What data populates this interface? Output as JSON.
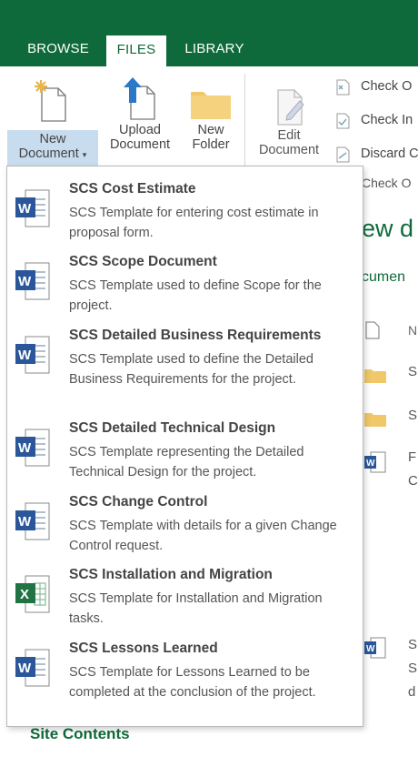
{
  "ribbon_tabs": {
    "browse": "BROWSE",
    "files": "FILES",
    "library": "LIBRARY"
  },
  "ribbon": {
    "new_document": {
      "line1": "New",
      "line2": "Document"
    },
    "upload_document": {
      "line1": "Upload",
      "line2": "Document"
    },
    "new_folder": {
      "line1": "New",
      "line2": "Folder"
    },
    "edit_document": {
      "line1": "Edit",
      "line2": "Document"
    },
    "check_out": "Check O",
    "check_in": "Check In",
    "discard": "Discard C",
    "group_label": "Check O"
  },
  "page": {
    "title": "ew d",
    "subtitle": "cumen",
    "column_header": "N",
    "rows": [
      "S",
      "S",
      "F",
      "C",
      "S",
      "S",
      "d"
    ],
    "site_contents": "Site Contents"
  },
  "menu_items": [
    {
      "title": "SCS Cost Estimate",
      "description": "SCS Template for entering cost estimate in proposal form.",
      "icon": "word-icon"
    },
    {
      "title": "SCS Scope Document",
      "description": "SCS Template used to define Scope for the project.",
      "icon": "word-icon"
    },
    {
      "title": "SCS Detailed Business Requirements",
      "description": "SCS Template used to define the Detailed Business Requirements for the project.",
      "icon": "word-icon"
    },
    {
      "title": "SCS Detailed Technical Design",
      "description": "SCS Template representing the Detailed Technical Design for the project.",
      "icon": "word-icon"
    },
    {
      "title": "SCS Change Control",
      "description": "SCS Template with details for a given Change Control request.",
      "icon": "word-icon"
    },
    {
      "title": "SCS Installation and Migration",
      "description": "SCS Template for Installation and Migration tasks.",
      "icon": "excel-icon"
    },
    {
      "title": "SCS Lessons Learned",
      "description": "SCS Template for Lessons Learned to be completed at the conclusion of the project.",
      "icon": "word-icon"
    }
  ],
  "colors": {
    "brand_green": "#0e6a3a",
    "word_blue": "#2b579a",
    "excel_green": "#217346",
    "highlight": "#c8dcef",
    "folder": "#f0c86a"
  }
}
